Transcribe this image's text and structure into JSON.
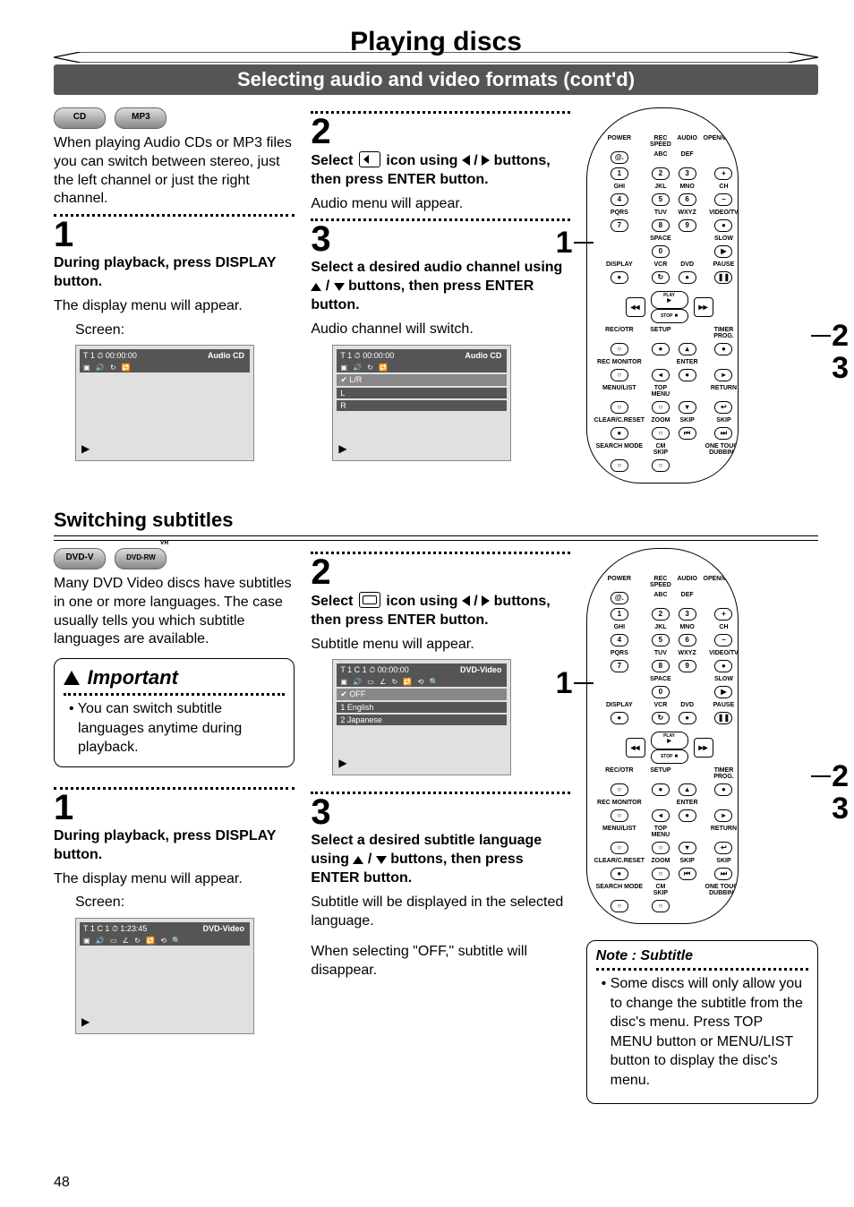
{
  "page": {
    "title": "Playing discs",
    "subtitle": "Selecting audio and video formats (cont'd)",
    "number": "48"
  },
  "audio_section": {
    "badges": [
      "CD",
      "MP3"
    ],
    "intro": "When playing Audio CDs or MP3 files you can switch between stereo, just the left channel or just the right channel.",
    "step1": {
      "num": "1",
      "head": "During playback, press DISPLAY button.",
      "text": "The display menu will appear.",
      "screen_label": "Screen:"
    },
    "step2": {
      "num": "2",
      "head_pre": "Select ",
      "head_mid": " icon using ",
      "head_slash": " / ",
      "head_post": " buttons, then press ENTER button.",
      "text": "Audio menu will appear."
    },
    "step3": {
      "num": "3",
      "head_pre": "Select a desired audio channel using ",
      "head_slash": " / ",
      "head_post": " buttons, then press ENTER button.",
      "text": "Audio channel will switch."
    },
    "osd1": {
      "tag": "Audio CD",
      "topline": "T   1   ⏱  00:00:00",
      "iconrow": "▣ 🔊 ↻ 🔁"
    },
    "osd2": {
      "tag": "Audio CD",
      "topline": "T   1   ⏱  00:00:00",
      "iconrow": "▣ 🔊 ↻ 🔁",
      "sel": "✔ L/R",
      "opts": [
        "L",
        "R"
      ]
    },
    "callouts": {
      "n1": "1",
      "n2": "2",
      "n3": "3"
    }
  },
  "subtitle_section": {
    "heading": "Switching subtitles",
    "badges": [
      "DVD-V",
      "DVD-RW"
    ],
    "badge_sup": "VR",
    "intro": "Many DVD Video discs have subtitles in one or more languages. The case usually tells you which subtitle languages are available.",
    "important": {
      "title": "Important",
      "text": "You can switch subtitle languages anytime during playback."
    },
    "step1": {
      "num": "1",
      "head": "During playback, press DISPLAY button.",
      "text": "The display menu will appear.",
      "screen_label": "Screen:"
    },
    "step2": {
      "num": "2",
      "head_pre": "Select ",
      "head_mid": " icon using ",
      "head_slash": " / ",
      "head_post": " buttons, then press ENTER button.",
      "text": "Subtitle menu will appear."
    },
    "step3": {
      "num": "3",
      "head_pre": "Select a desired subtitle language using ",
      "head_slash": " / ",
      "head_post": " buttons, then press ENTER button.",
      "text1": "Subtitle will be displayed in the selected language.",
      "text2": "When selecting \"OFF,\" subtitle will disappear."
    },
    "osd1": {
      "tag": "DVD-Video",
      "topline": "T   1   C   1   ⏱   1:23:45",
      "iconrow": "▣ 🔊 ▭ ∠ ↻ 🔁 ⟲ 🔍"
    },
    "osd2": {
      "tag": "DVD-Video",
      "topline": "T   1   C   1   ⏱  00:00:00",
      "iconrow": "▣ 🔊 ▭ ∠ ↻ 🔁 ⟲ 🔍",
      "sel": "✔  OFF",
      "opts": [
        "1 English",
        "2 Japanese"
      ]
    },
    "note": {
      "title": "Note : Subtitle",
      "text": "Some discs will only allow you to change the subtitle from the disc's menu. Press TOP MENU button or MENU/LIST button to display the disc's menu."
    },
    "callouts": {
      "n1": "1",
      "n2": "2",
      "n3": "3"
    }
  },
  "remote": {
    "rows": [
      [
        "POWER",
        "REC SPEED",
        "AUDIO",
        "OPEN/CLOSE"
      ],
      [
        "@.",
        "ABC",
        "DEF",
        ""
      ],
      [
        "1",
        "2",
        "3",
        "+"
      ],
      [
        "GHI",
        "JKL",
        "MNO",
        "CH"
      ],
      [
        "4",
        "5",
        "6",
        "−"
      ],
      [
        "PQRS",
        "TUV",
        "WXYZ",
        "VIDEO/TV"
      ],
      [
        "7",
        "8",
        "9",
        "●"
      ],
      [
        "",
        "SPACE",
        "",
        "SLOW"
      ],
      [
        "",
        "0",
        "",
        "▶"
      ],
      [
        "DISPLAY",
        "VCR",
        "DVD",
        "PAUSE"
      ],
      [
        "●",
        "↻",
        "●",
        "❚❚"
      ],
      [
        "__PLAY__"
      ],
      [
        "REC/OTR",
        "SETUP",
        "",
        "TIMER PROG."
      ],
      [
        "○",
        "●",
        "▴",
        "●"
      ],
      [
        "REC MONITOR",
        "",
        "ENTER",
        ""
      ],
      [
        "○",
        "◂",
        "●",
        "▸"
      ],
      [
        "MENU/LIST",
        "TOP MENU",
        "",
        "RETURN"
      ],
      [
        "○",
        "○",
        "▾",
        "↩"
      ],
      [
        "CLEAR/C.RESET",
        "ZOOM",
        "SKIP",
        "SKIP"
      ],
      [
        "●",
        "○",
        "⏮",
        "⏭"
      ],
      [
        "SEARCH MODE",
        "CM SKIP",
        "",
        "ONE TOUCH DUBBING"
      ],
      [
        "○",
        "○",
        "",
        ""
      ]
    ]
  }
}
